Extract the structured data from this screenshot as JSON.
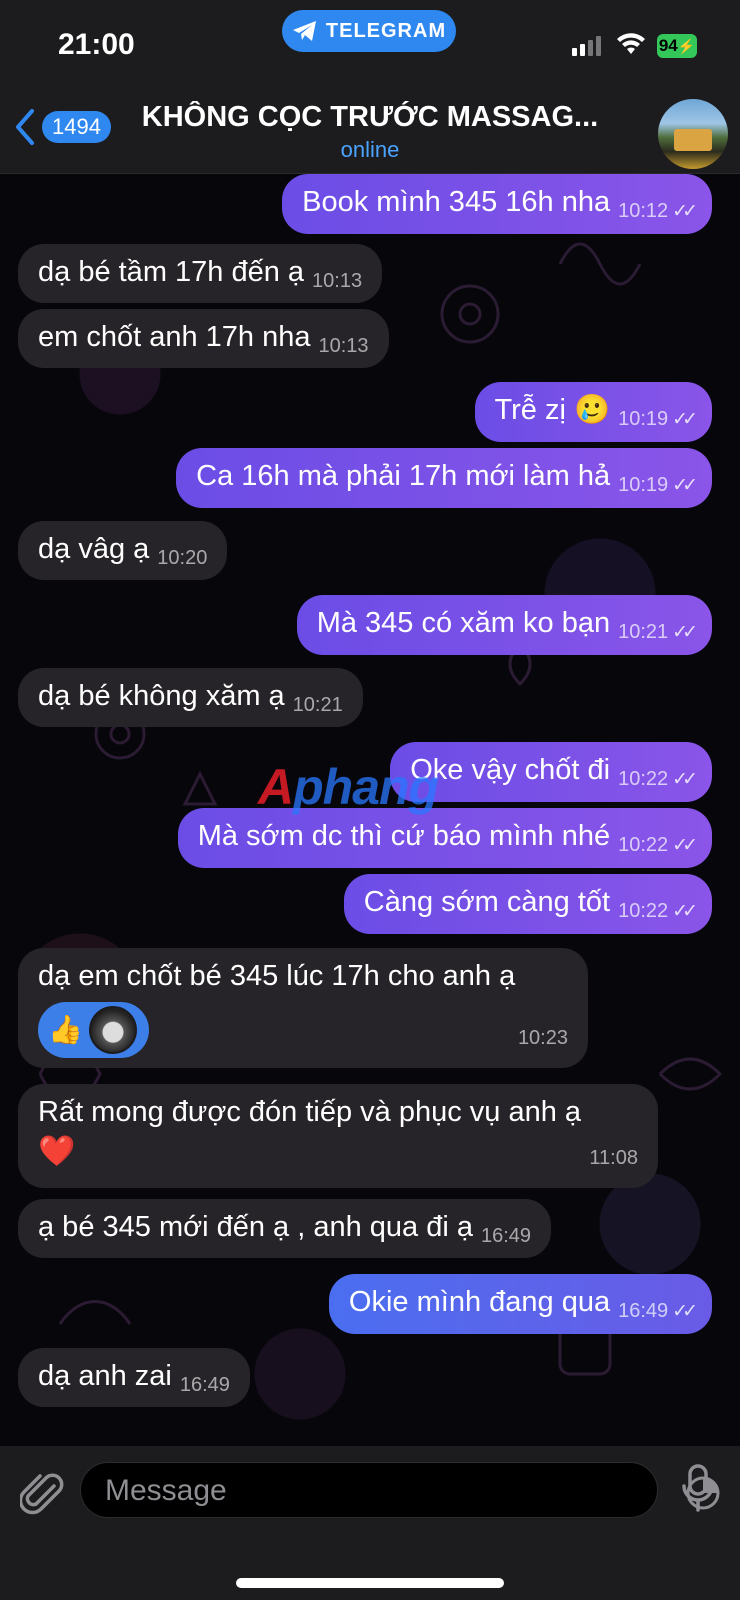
{
  "status_bar": {
    "time": "21:00",
    "app_pill": "TELEGRAM",
    "battery": "94"
  },
  "header": {
    "back_count": "1494",
    "title": "KHÔNG CỌC TRƯỚC MASSAG...",
    "status": "online"
  },
  "messages": [
    {
      "dir": "out",
      "text": "Book mình 345 16h nha",
      "time": "10:12"
    },
    {
      "dir": "in",
      "text": "dạ bé tầm 17h đến ạ",
      "time": "10:13"
    },
    {
      "dir": "in",
      "text": "em chốt anh 17h nha",
      "time": "10:13"
    },
    {
      "dir": "out",
      "text": "Trễ zị 🥲",
      "time": "10:19"
    },
    {
      "dir": "out",
      "text": "Ca 16h mà phải 17h mới làm hả",
      "time": "10:19"
    },
    {
      "dir": "in",
      "text": "dạ vâg ạ",
      "time": "10:20"
    },
    {
      "dir": "out",
      "text": "Mà 345 có xăm ko bạn",
      "time": "10:21"
    },
    {
      "dir": "in",
      "text": "dạ bé không xăm ạ",
      "time": "10:21"
    },
    {
      "dir": "out",
      "text": "Oke vậy chốt đi",
      "time": "10:22"
    },
    {
      "dir": "out",
      "text": "Mà sớm dc thì cứ báo mình nhé",
      "time": "10:22"
    },
    {
      "dir": "out",
      "text": "Càng sớm càng tốt",
      "time": "10:22"
    },
    {
      "dir": "in",
      "text": "dạ em chốt bé 345 lúc 17h cho anh ạ",
      "time": "10:23",
      "reaction": "👍"
    },
    {
      "dir": "in",
      "text": "Rất mong được đón tiếp và phục vụ anh ạ",
      "emoji": "❤️",
      "time": "11:08"
    },
    {
      "dir": "in",
      "text": "ạ bé 345 mới đến ạ , anh qua đi ạ",
      "time": "16:49"
    },
    {
      "dir": "out",
      "text": "Okie mình đang qua",
      "time": "16:49"
    },
    {
      "dir": "in",
      "text": "dạ anh zai",
      "time": "16:49"
    }
  ],
  "watermark": {
    "first": "A",
    "rest": "phang"
  },
  "input": {
    "placeholder": "Message"
  },
  "colors": {
    "accent": "#2f88f0",
    "outgoing": "#8a55e8",
    "incoming": "#262428"
  }
}
